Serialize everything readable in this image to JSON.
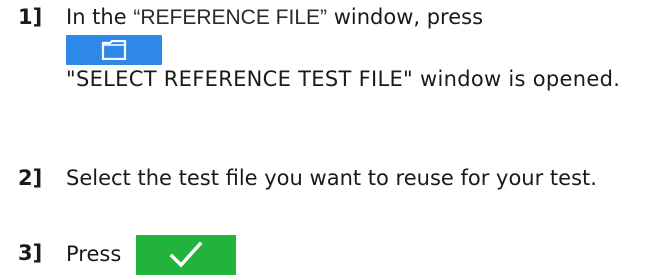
{
  "steps": [
    {
      "number": "1]",
      "prefix": "In the ",
      "quoted": "“REFERENCE FILE”",
      "suffix": " window, press",
      "button_icon": "folder-icon",
      "result": "\"SELECT REFERENCE TEST FILE\" window is opened."
    },
    {
      "number": "2]",
      "text": "Select the test file you want to reuse for your test."
    },
    {
      "number": "3]",
      "text": "Press",
      "button_icon": "checkmark-icon"
    }
  ],
  "colors": {
    "folder_button": "#2d88e8",
    "check_button": "#22b33c"
  }
}
